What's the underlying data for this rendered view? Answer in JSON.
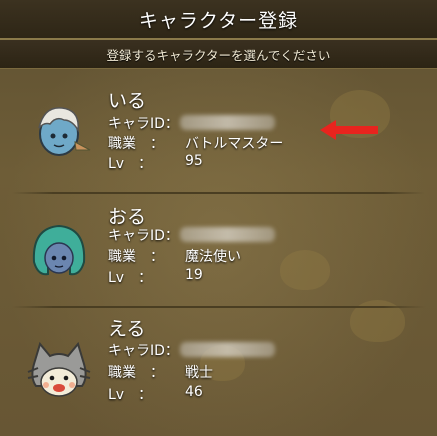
{
  "header": {
    "title": "キャラクター登録"
  },
  "subheader": {
    "text": "登録するキャラクターを選んでください"
  },
  "labels": {
    "id": "キャラID：",
    "job": "職業　：",
    "level": "Lv　："
  },
  "characters": [
    {
      "name": "いる",
      "job": "バトルマスター",
      "level": "95",
      "avatar_icon": "elf-character-icon"
    },
    {
      "name": "おる",
      "job": "魔法使い",
      "level": "19",
      "avatar_icon": "green-haired-character-icon"
    },
    {
      "name": "える",
      "job": "戦士",
      "level": "46",
      "avatar_icon": "cat-character-icon"
    }
  ],
  "colors": {
    "arrow": "#e8241e",
    "text": "#ffffff",
    "background": "#6b5b34"
  }
}
